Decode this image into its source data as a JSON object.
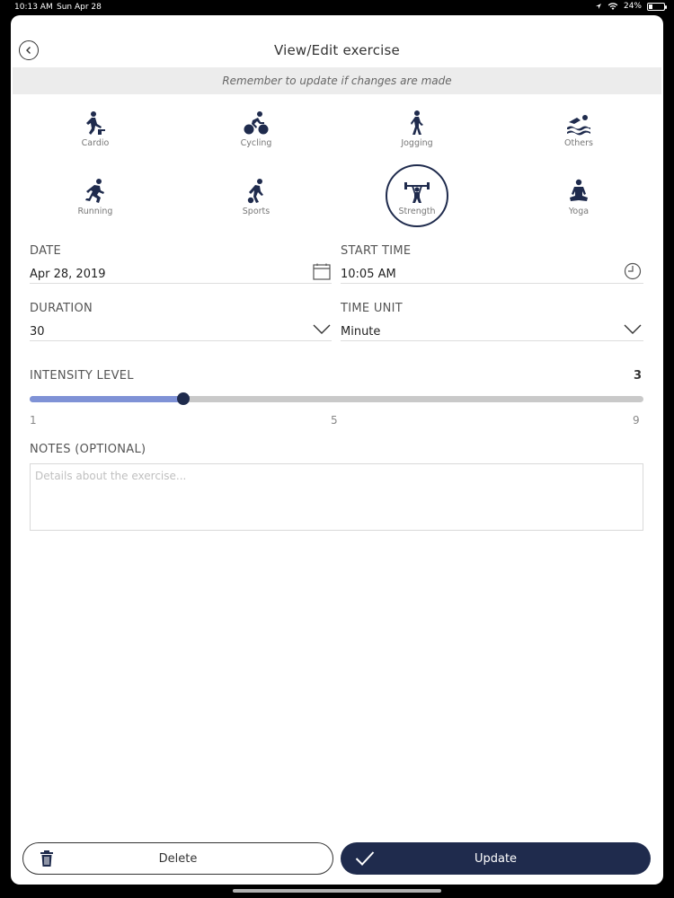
{
  "status": {
    "time": "10:13 AM",
    "date": "Sun Apr 28",
    "battery": "24%"
  },
  "header": {
    "title": "View/Edit exercise"
  },
  "banner": {
    "text": "Remember to update if changes are made"
  },
  "types": [
    {
      "label": "Cardio",
      "icon": "cardio-icon"
    },
    {
      "label": "Cycling",
      "icon": "cycling-icon"
    },
    {
      "label": "Jogging",
      "icon": "jogging-icon"
    },
    {
      "label": "Others",
      "icon": "swimming-icon"
    },
    {
      "label": "Running",
      "icon": "running-icon"
    },
    {
      "label": "Sports",
      "icon": "sports-icon"
    },
    {
      "label": "Strength",
      "icon": "strength-icon",
      "selected": true
    },
    {
      "label": "Yoga",
      "icon": "yoga-icon"
    }
  ],
  "form": {
    "date_label": "DATE",
    "date_value": "Apr 28, 2019",
    "start_time_label": "START TIME",
    "start_time_value": "10:05 AM",
    "duration_label": "DURATION",
    "duration_value": "30",
    "time_unit_label": "TIME UNIT",
    "time_unit_value": "Minute",
    "intensity_label": "INTENSITY LEVEL",
    "intensity_value": "3",
    "intensity_min": "1",
    "intensity_mid": "5",
    "intensity_max": "9",
    "notes_label": "NOTES (OPTIONAL)",
    "notes_placeholder": "Details about the exercise..."
  },
  "buttons": {
    "delete": "Delete",
    "update": "Update"
  },
  "colors": {
    "primary": "#1f2b4d",
    "slider_fill": "#7f92d6",
    "banner_bg": "#ececec"
  }
}
